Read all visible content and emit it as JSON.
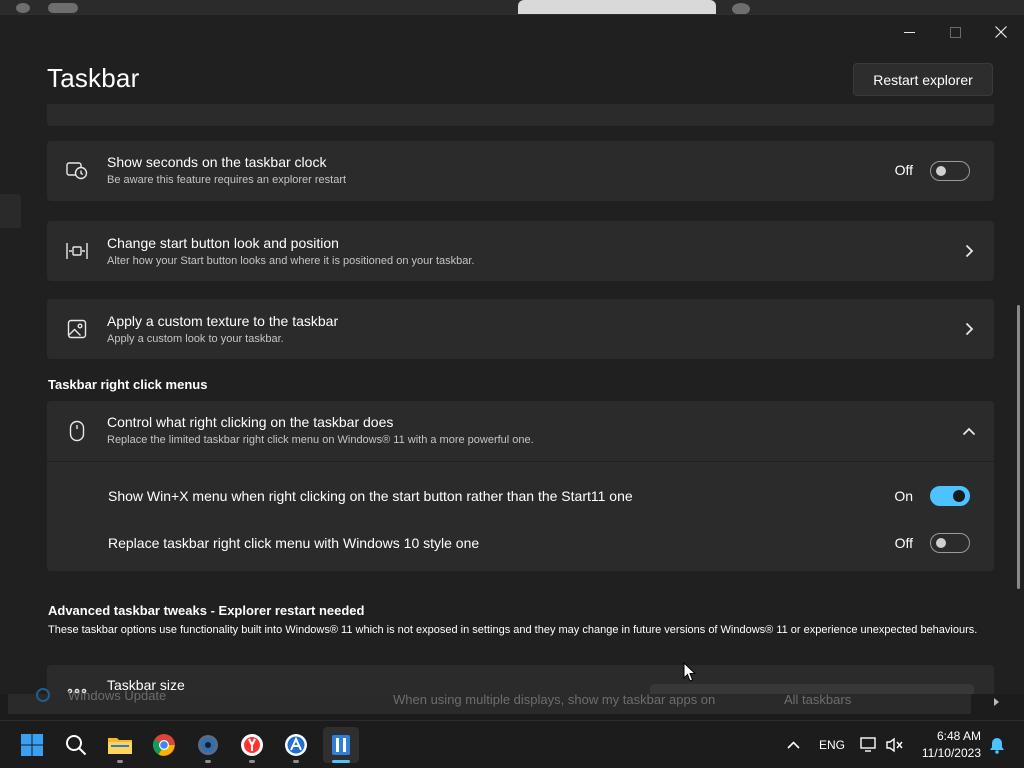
{
  "window": {
    "title": "Taskbar",
    "restart_button": "Restart explorer"
  },
  "settings": {
    "seconds": {
      "title": "Show seconds on the taskbar clock",
      "subtitle": "Be aware this feature requires an explorer restart",
      "state": "Off",
      "icon": "clock-icon"
    },
    "start_button": {
      "title": "Change start button look and position",
      "subtitle": "Alter how your Start button looks and where it is positioned on your taskbar.",
      "icon": "start-button-icon"
    },
    "texture": {
      "title": "Apply a custom texture to the taskbar",
      "subtitle": "Apply a custom look to your taskbar.",
      "icon": "image-icon"
    }
  },
  "right_click_section": {
    "heading": "Taskbar right click menus",
    "card": {
      "title": "Control what right clicking on the taskbar does",
      "subtitle": "Replace the limited taskbar right click menu on Windows® 11 with a more powerful one.",
      "icon": "mouse-icon"
    },
    "options": [
      {
        "label": "Show Win+X menu when right clicking on the start button rather than the Start11 one",
        "state": "On"
      },
      {
        "label": "Replace taskbar right click menu with Windows 10 style one",
        "state": "Off"
      }
    ]
  },
  "advanced_section": {
    "heading": "Advanced taskbar tweaks - Explorer restart needed",
    "description": "These taskbar options use functionality built into Windows® 11 which is not exposed in settings and they may change in future versions of Windows® 11 or experience unexpected behaviours.",
    "partial_card_title": "Taskbar size",
    "partial_card_icon": "taskbar-size-icon"
  },
  "background_window": {
    "left_text": "Windows Update",
    "mid_text": "When using multiple displays, show my taskbar apps on",
    "dropdown_value": "All taskbars"
  },
  "taskbar": {
    "apps": [
      "windows-start-icon",
      "search-icon",
      "file-explorer-icon",
      "chrome-icon",
      "settings-icon",
      "yandex-browser-icon",
      "app-icon",
      "start11-icon"
    ],
    "tray_language": "ENG",
    "time": "6:48 AM",
    "date": "11/10/2023"
  },
  "colors": {
    "accent": "#4cc2ff",
    "card": "#2b2b2b",
    "background": "#202020"
  }
}
